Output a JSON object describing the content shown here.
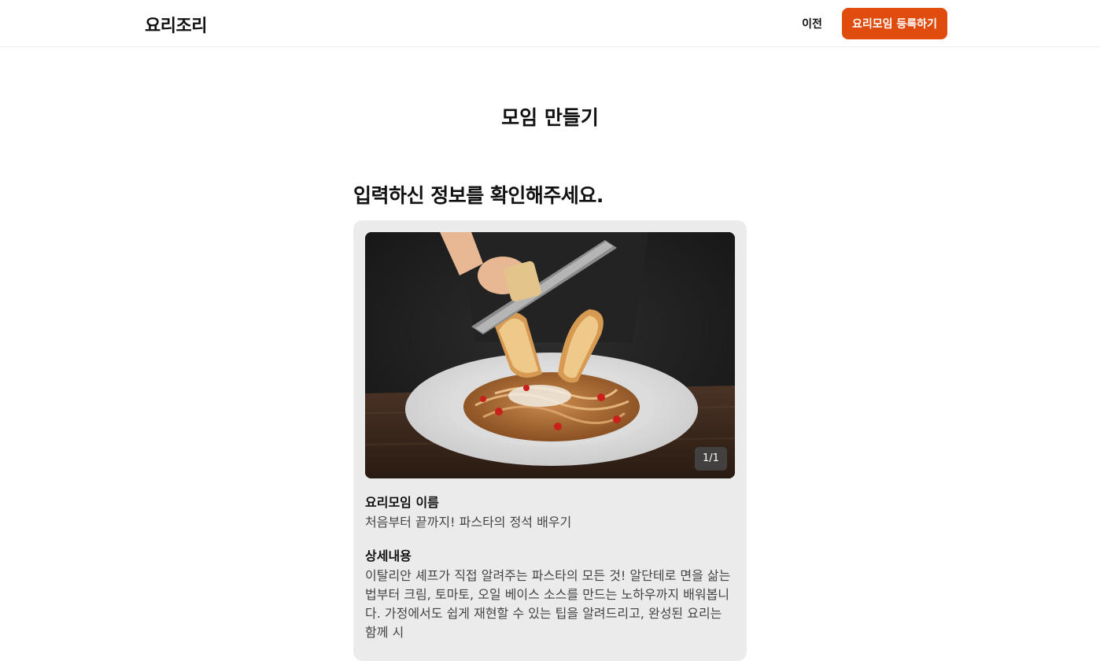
{
  "header": {
    "logo": "요리조리",
    "prev_label": "이전",
    "register_label": "요리모임 등록하기"
  },
  "page": {
    "title": "모임 만들기",
    "section_heading": "입력하신 정보를 확인해주세요."
  },
  "card": {
    "image_counter": "1/1",
    "name_label": "요리모임 이름",
    "name_value": "처음부터 끝까지! 파스타의 정석 배우기",
    "detail_label": "상세내용",
    "detail_value": "이탈리안 셰프가 직접 알려주는 파스타의 모든 것! 알단테로 면을 삶는 법부터 크림, 토마토, 오일 베이스 소스를 만드는 노하우까지 배워봅니다. 가정에서도 쉽게 재현할 수 있는 팁을 알려드리고, 완성된 요리는 함께 시"
  },
  "colors": {
    "accent": "#e04b0e",
    "card_bg": "#ebebeb"
  }
}
